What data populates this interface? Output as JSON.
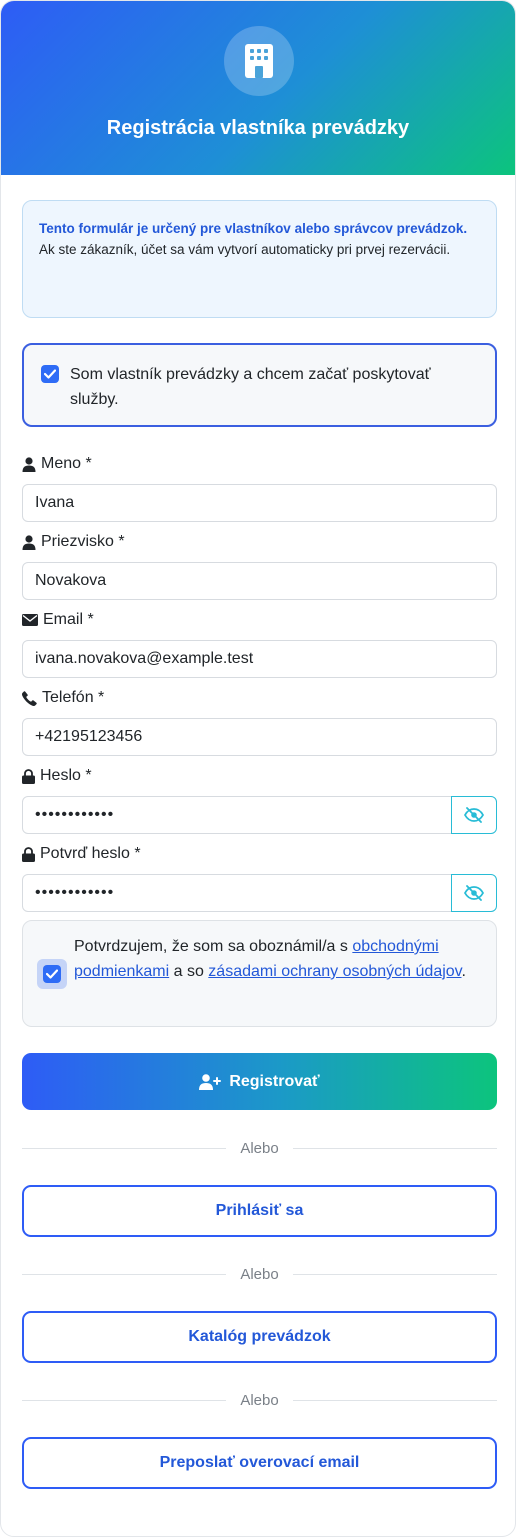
{
  "header": {
    "title": "Registrácia vlastníka prevádzky",
    "icon": "building-icon"
  },
  "info": {
    "strong_text": "Tento formulár je určený pre vlastníkov alebo správcov prevádzok.",
    "text": "Ak ste zákazník, účet sa vám vytvorí automaticky pri prvej rezervácii."
  },
  "owner_checkbox": {
    "checked": true,
    "label": "Som vlastník prevádzky a chcem začať poskytovať služby."
  },
  "fields": {
    "first_name": {
      "label": "Meno *",
      "value": "Ivana",
      "icon": "user-icon"
    },
    "last_name": {
      "label": "Priezvisko *",
      "value": "Novakova",
      "icon": "user-icon"
    },
    "email": {
      "label": "Email *",
      "value": "ivana.novakova@example.test",
      "icon": "envelope-icon"
    },
    "phone": {
      "label": "Telefón *",
      "value": "+42195123456",
      "icon": "phone-icon"
    },
    "password": {
      "label": "Heslo *",
      "value": "••••••••••••",
      "icon": "lock-icon"
    },
    "password_confirm": {
      "label": "Potvrď heslo *",
      "value": "••••••••••••",
      "icon": "lock-icon"
    }
  },
  "terms": {
    "checked": true,
    "text_1": "Potvrdzujem, že som sa oboznámil/a s ",
    "link_1": "obchodnými podmienkami",
    "text_2": " a so ",
    "link_2": "zásadami ochrany osobných údajov",
    "text_3": "."
  },
  "actions": {
    "register_label": "Registrovať",
    "divider_label": "Alebo",
    "login_label": "Prihlásiť sa",
    "catalog_label": "Katalóg prevádzok",
    "resend_label": "Preposlať overovací email"
  },
  "colors": {
    "primary": "#2e5cf6",
    "accent_green": "#0cc47d",
    "eye_icon": "#28bcd6"
  }
}
